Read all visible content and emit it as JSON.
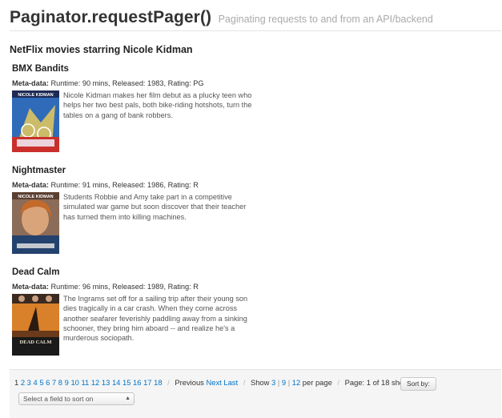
{
  "header": {
    "title": "Paginator.requestPager()",
    "subtitle": "Paginating requests to and from an API/backend"
  },
  "section_heading": "NetFlix movies starring Nicole Kidman",
  "meta_label": "Meta-data:",
  "movies": [
    {
      "title": "BMX Bandits",
      "meta": "Runtime: 90 mins, Released: 1983, Rating: PG",
      "synopsis": "Nicole Kidman makes her film debut as a plucky teen who helps her two best pals, both bike-riding hotshots, turn the tables on a gang of bank robbers.",
      "poster_top_text": "NICOLE KIDMAN",
      "poster_colors": [
        "#3b78c4",
        "#c9302c"
      ]
    },
    {
      "title": "Nightmaster",
      "meta": "Runtime: 91 mins, Released: 1986, Rating: R",
      "synopsis": "Students Robbie and Amy take part in a competitive simulated war game but soon discover that their teacher has turned them into killing machines.",
      "poster_top_text": "NICOLE KIDMAN",
      "poster_colors": [
        "#b07a52",
        "#2a4a7a"
      ]
    },
    {
      "title": "Dead Calm",
      "meta": "Runtime: 96 mins, Released: 1989, Rating: R",
      "synopsis": "The Ingrams set off for a sailing trip after their young son dies tragically in a car crash. When they come across another seafarer feverishly paddling away from a sinking schooner, they bring him aboard -- and realize he's a murderous sociopath.",
      "poster_top_text": "DEAD CALM",
      "poster_colors": [
        "#d8802a",
        "#1a1a1a"
      ]
    }
  ],
  "pager": {
    "pages": [
      "1",
      "2",
      "3",
      "4",
      "5",
      "6",
      "7",
      "8",
      "9",
      "10",
      "11",
      "12",
      "13",
      "14",
      "15",
      "16",
      "17",
      "18"
    ],
    "current_page": "1",
    "previous_label": "Previous",
    "next_label": "Next",
    "last_label": "Last",
    "show_label": "Show",
    "per_page_options": [
      "3",
      "9",
      "12"
    ],
    "per_page_label": "per page",
    "page_info": "Page: 1 of 18 shown",
    "sort_button": "Sort by:",
    "sort_placeholder": "Select a field to sort on"
  },
  "colors": {
    "link": "#0073c6",
    "pager_bg": "#f5f5f5"
  }
}
